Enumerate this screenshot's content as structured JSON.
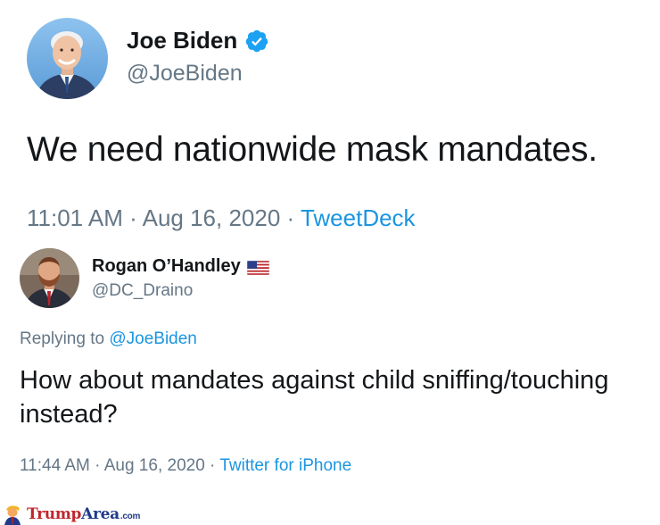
{
  "tweet1": {
    "author_name": "Joe Biden",
    "verified": true,
    "handle": "@JoeBiden",
    "text": "We need nationwide mask mandates.",
    "time": "11:01 AM",
    "separator": " · ",
    "date": "Aug 16, 2020",
    "source": "TweetDeck"
  },
  "tweet2": {
    "author_name": "Rogan O’Handley",
    "flag_icon": "us-flag-emoji",
    "handle": "@DC_Draino",
    "replying_prefix": "Replying to ",
    "replying_to": "@JoeBiden",
    "text": "How about mandates against child sniffing/touching instead?",
    "time": "11:44 AM",
    "separator": " · ",
    "date": "Aug 16, 2020",
    "source": "Twitter for iPhone"
  },
  "watermark": {
    "brand_part1": "Trump",
    "brand_part2": "Area",
    "brand_suffix": ".com"
  },
  "colors": {
    "text_primary": "#14171a",
    "text_secondary": "#657786",
    "link_blue": "#1b95e0",
    "verified_blue": "#1da1f2",
    "watermark_red": "#c0272d",
    "watermark_navy": "#1f3a8a"
  }
}
